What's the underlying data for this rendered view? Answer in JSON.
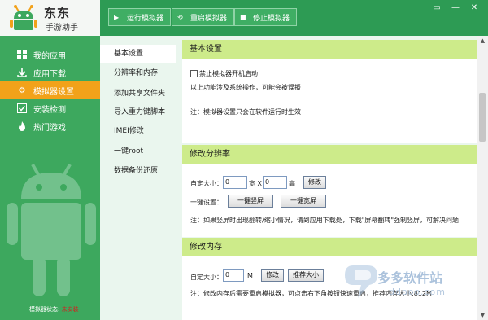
{
  "app": {
    "title": "东东",
    "subtitle": "手游助手"
  },
  "toolbar": {
    "run": "运行模拟器",
    "restart": "重启模拟器",
    "stop": "停止模拟器"
  },
  "sidebar": {
    "items": [
      {
        "label": "我的应用",
        "icon": "grid-icon"
      },
      {
        "label": "应用下载",
        "icon": "download-icon"
      },
      {
        "label": "模拟器设置",
        "icon": "gear-icon",
        "active": true
      },
      {
        "label": "安装检测",
        "icon": "check-icon"
      },
      {
        "label": "热门游戏",
        "icon": "fire-icon"
      }
    ],
    "status_label": "模拟器状态:",
    "status_value": "未安装"
  },
  "submenu": {
    "items": [
      "基本设置",
      "分辨率和内存",
      "添加共享文件夹",
      "导入重力键脚本",
      "IMEI修改",
      "一键root",
      "数据备份还原"
    ]
  },
  "basic": {
    "title": "基本设置",
    "checkbox_label": "禁止模拟器开机启动",
    "note1": "以上功能涉及系统操作，可能会被误报",
    "note2": "注：模拟器设置只会在软件运行时生效"
  },
  "resolution": {
    "title": "修改分辨率",
    "custom_label": "自定大小：",
    "width_value": "0",
    "width_unit": "宽 X",
    "height_value": "0",
    "height_unit": "高",
    "modify": "修改",
    "quick_label": "一键设置：",
    "portrait": "一键竖屏",
    "landscape": "一键宽屏",
    "note": "注：如果竖屏时出现翻转/缩小情况，请到应用下载处，下载\"屏幕翻转\"强制竖屏，可解决问题"
  },
  "memory": {
    "title": "修改内存",
    "custom_label": "自定大小：",
    "value": "0",
    "unit": "M",
    "modify": "修改",
    "recommend": "推荐大小",
    "note": "注：修改内存后需要重启模拟器，可点击右下角按钮快速重启，推荐内存大小:812M"
  },
  "watermark": {
    "text": "多多软件站",
    "url": "ddooo.com"
  },
  "colors": {
    "brand_green": "#2d9b54",
    "sidebar_green": "#3da85e",
    "active_orange": "#f2a21a",
    "section_green": "#cdeb8a"
  }
}
